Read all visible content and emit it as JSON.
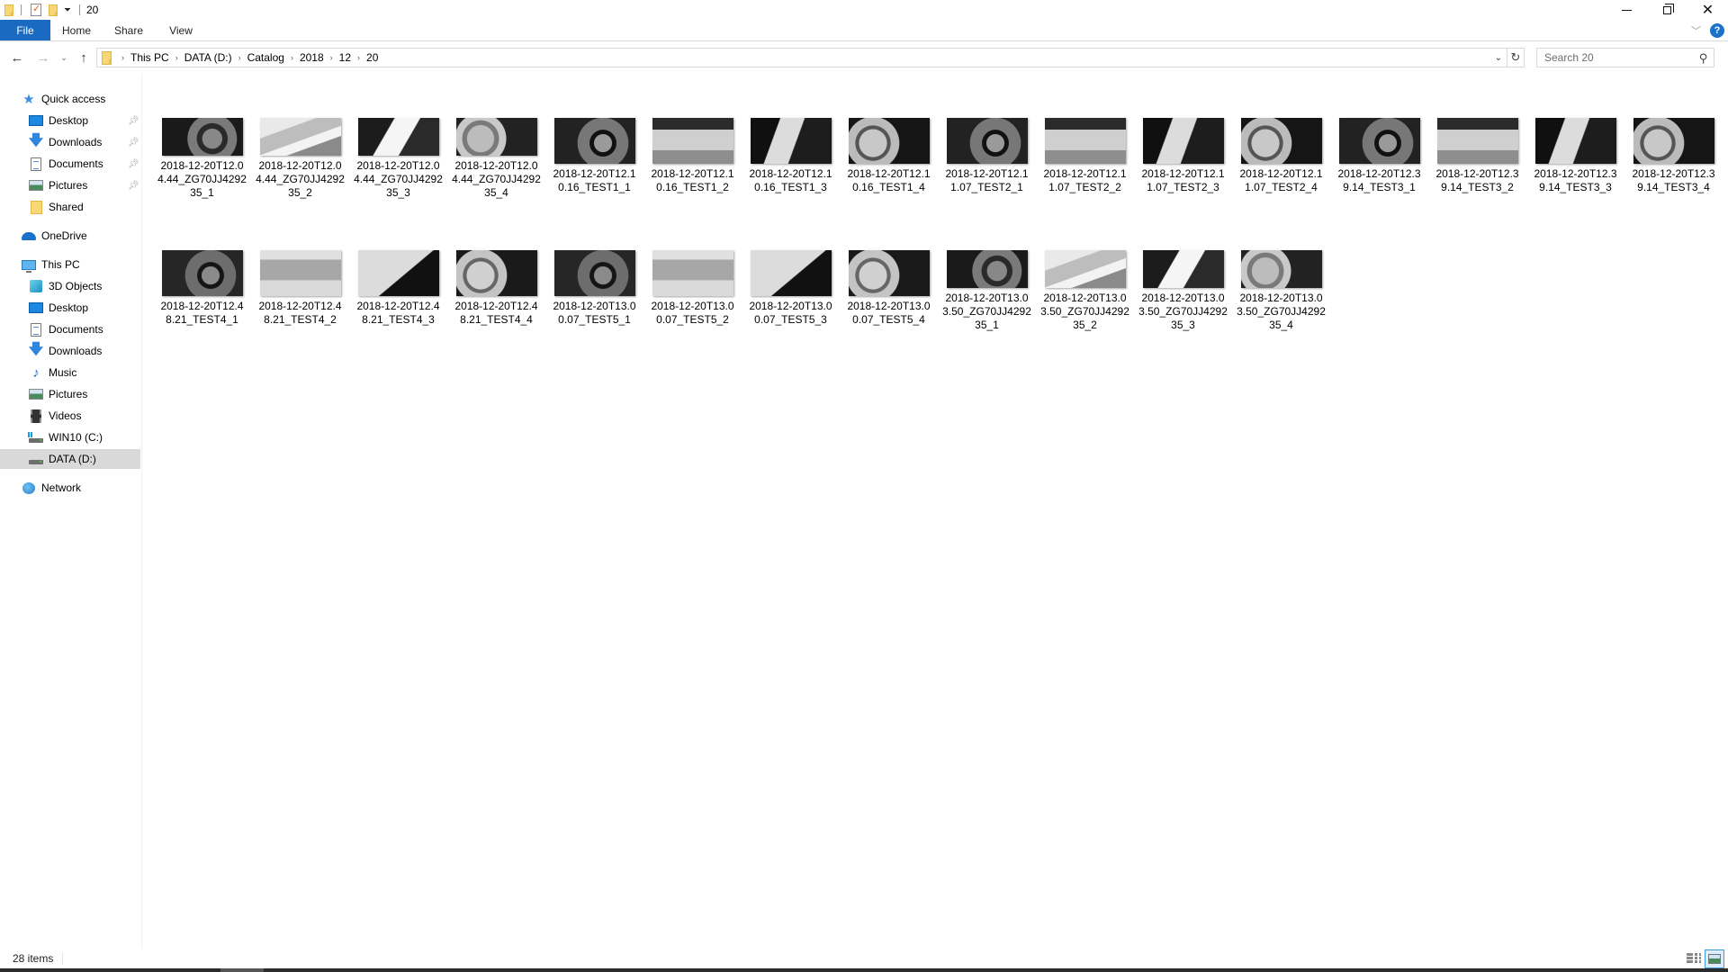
{
  "window": {
    "title": "20",
    "quick_access_toolbar": [
      "folder-icon",
      "properties-icon",
      "new-folder-icon",
      "customize-dropdown"
    ]
  },
  "window_controls": {
    "minimize": "minimize",
    "restore": "restore",
    "close": "close"
  },
  "ribbon": {
    "tabs": [
      {
        "label": "File",
        "active": true
      },
      {
        "label": "Home"
      },
      {
        "label": "Share"
      },
      {
        "label": "View"
      }
    ],
    "accent_color": "#1a6ac1"
  },
  "navigation": {
    "breadcrumb": [
      "This PC",
      "DATA (D:)",
      "Catalog",
      "2018",
      "12",
      "20"
    ],
    "search_placeholder": "Search 20"
  },
  "sidebar": {
    "quick_access": {
      "label": "Quick access",
      "items": [
        {
          "label": "Desktop",
          "icon": "desktop-icon",
          "pinned": true
        },
        {
          "label": "Downloads",
          "icon": "downloads-icon",
          "pinned": true
        },
        {
          "label": "Documents",
          "icon": "documents-icon",
          "pinned": true
        },
        {
          "label": "Pictures",
          "icon": "pictures-icon",
          "pinned": true
        },
        {
          "label": "Shared",
          "icon": "folder-icon",
          "pinned": false
        }
      ]
    },
    "onedrive": {
      "label": "OneDrive"
    },
    "this_pc": {
      "label": "This PC",
      "items": [
        {
          "label": "3D Objects",
          "icon": "3d-objects-icon"
        },
        {
          "label": "Desktop",
          "icon": "desktop-icon"
        },
        {
          "label": "Documents",
          "icon": "documents-icon"
        },
        {
          "label": "Downloads",
          "icon": "downloads-icon"
        },
        {
          "label": "Music",
          "icon": "music-icon"
        },
        {
          "label": "Pictures",
          "icon": "pictures-icon"
        },
        {
          "label": "Videos",
          "icon": "videos-icon"
        },
        {
          "label": "WIN10 (C:)",
          "icon": "system-drive-icon"
        },
        {
          "label": "DATA (D:)",
          "icon": "drive-icon",
          "selected": true
        }
      ]
    },
    "network": {
      "label": "Network"
    }
  },
  "files": [
    {
      "name": "2018-12-20T12.04.44_ZG70JJ429235_1"
    },
    {
      "name": "2018-12-20T12.04.44_ZG70JJ429235_2"
    },
    {
      "name": "2018-12-20T12.04.44_ZG70JJ429235_3"
    },
    {
      "name": "2018-12-20T12.04.44_ZG70JJ429235_4"
    },
    {
      "name": "2018-12-20T12.10.16_TEST1_1"
    },
    {
      "name": "2018-12-20T12.10.16_TEST1_2"
    },
    {
      "name": "2018-12-20T12.10.16_TEST1_3"
    },
    {
      "name": "2018-12-20T12.10.16_TEST1_4"
    },
    {
      "name": "2018-12-20T12.11.07_TEST2_1"
    },
    {
      "name": "2018-12-20T12.11.07_TEST2_2"
    },
    {
      "name": "2018-12-20T12.11.07_TEST2_3"
    },
    {
      "name": "2018-12-20T12.11.07_TEST2_4"
    },
    {
      "name": "2018-12-20T12.39.14_TEST3_1"
    },
    {
      "name": "2018-12-20T12.39.14_TEST3_2"
    },
    {
      "name": "2018-12-20T12.39.14_TEST3_3"
    },
    {
      "name": "2018-12-20T12.39.14_TEST3_4"
    },
    {
      "name": "2018-12-20T12.48.21_TEST4_1"
    },
    {
      "name": "2018-12-20T12.48.21_TEST4_2"
    },
    {
      "name": "2018-12-20T12.48.21_TEST4_3"
    },
    {
      "name": "2018-12-20T12.48.21_TEST4_4"
    },
    {
      "name": "2018-12-20T13.00.07_TEST5_1"
    },
    {
      "name": "2018-12-20T13.00.07_TEST5_2"
    },
    {
      "name": "2018-12-20T13.00.07_TEST5_3"
    },
    {
      "name": "2018-12-20T13.00.07_TEST5_4"
    },
    {
      "name": "2018-12-20T13.03.50_ZG70JJ429235_1"
    },
    {
      "name": "2018-12-20T13.03.50_ZG70JJ429235_2"
    },
    {
      "name": "2018-12-20T13.03.50_ZG70JJ429235_3"
    },
    {
      "name": "2018-12-20T13.03.50_ZG70JJ429235_4"
    }
  ],
  "statusbar": {
    "item_count": "28 items",
    "view_mode": "large-icons"
  }
}
